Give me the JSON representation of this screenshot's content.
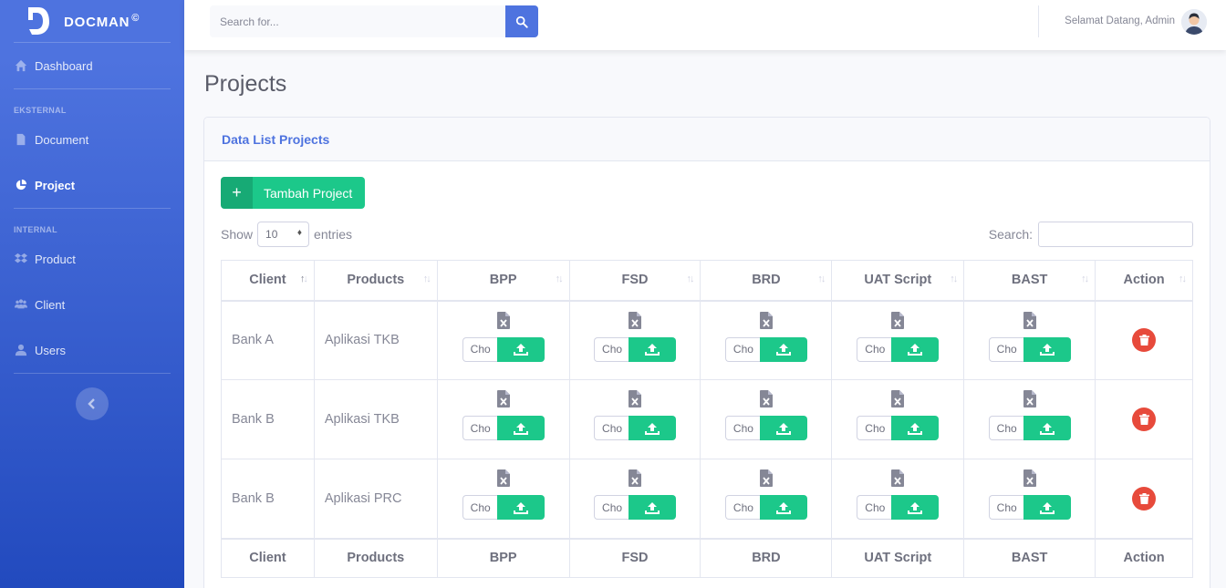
{
  "brand": {
    "name": "DOCMAN",
    "mark": "©"
  },
  "sidebar": {
    "dashboard": "Dashboard",
    "heading_external": "EKSTERNAL",
    "document": "Document",
    "project": "Project",
    "heading_internal": "INTERNAL",
    "product": "Product",
    "client": "Client",
    "users": "Users"
  },
  "topbar": {
    "search_placeholder": "Search for...",
    "greeting": "Selamat Datang, Admin"
  },
  "page": {
    "title": "Projects"
  },
  "card": {
    "header": "Data List Projects",
    "add_button": "Tambah Project",
    "add_icon": "+",
    "show_label": "Show",
    "entries_value": "10",
    "entries_label": "entries",
    "search_label": "Search:"
  },
  "table": {
    "columns": [
      "Client",
      "Products",
      "BPP",
      "FSD",
      "BRD",
      "UAT Script",
      "BAST",
      "Action"
    ],
    "choose_text": "Cho",
    "rows": [
      {
        "client": "Bank A",
        "product": "Aplikasi TKB"
      },
      {
        "client": "Bank B",
        "product": "Aplikasi TKB"
      },
      {
        "client": "Bank B",
        "product": "Aplikasi PRC"
      }
    ]
  },
  "colors": {
    "primary": "#4e73df",
    "success": "#1cc88a",
    "danger": "#e74a3b"
  }
}
